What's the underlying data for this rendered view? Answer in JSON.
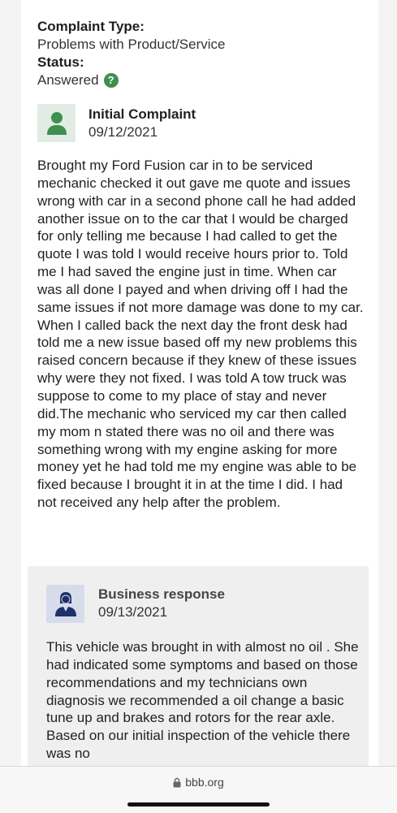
{
  "meta": {
    "complaint_type_label": "Complaint Type:",
    "complaint_type_value": "Problems with Product/Service",
    "status_label": "Status:",
    "status_value": "Answered",
    "status_help_icon": "question-circle-icon"
  },
  "complaint": {
    "title": "Initial Complaint",
    "date": "09/12/2021",
    "avatar_icon": "person-icon",
    "avatar_color": "#3f8f4e",
    "text": "Brought my Ford Fusion car in to be serviced mechanic checked it out gave me quote and issues wrong with car in a second phone call he had added another issue on to the car that I would be charged for only telling me because I had called to get the quote I was told I would receive hours prior to. Told me I had saved the engine just in time. When car was all done I payed and when driving off I had the same issues if not more damage was done to my car. When I called back the next day the front desk had told me a new issue based off my new problems this raised concern because if they knew of these issues why were they not fixed. I was told A tow truck was suppose to come to my place of stay and never did.The mechanic who serviced my car then called my mom n stated there was no oil and there was something wrong with my engine asking for more money yet he had told me my engine was able to be fixed because I brought it in at the time I did. I had not received any help after the problem."
  },
  "response": {
    "title": "Business response",
    "date": "09/13/2021",
    "avatar_icon": "business-person-icon",
    "avatar_color": "#1e2f6b",
    "text": "This vehicle was brought in with almost no oil . She had indicated some symptoms and based on those recommendations and my technicians own diagnosis we recommended a oil change a basic tune up and brakes and rotors for the rear axle. Based on our initial inspection of the vehicle there was no"
  },
  "browser": {
    "url": "bbb.org",
    "lock_icon": "lock-icon"
  }
}
